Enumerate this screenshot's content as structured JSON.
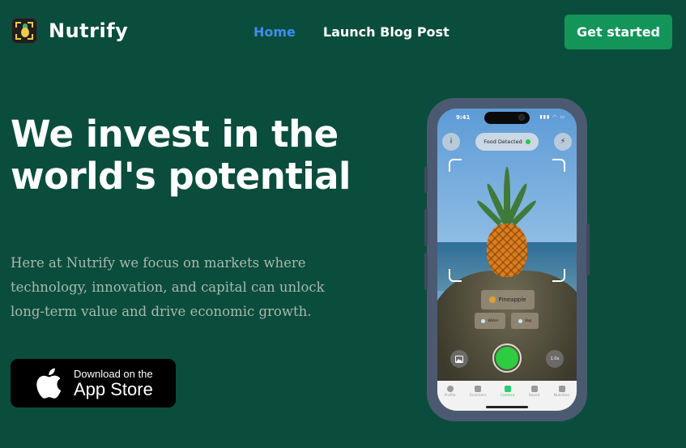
{
  "brand": {
    "name": "Nutrify",
    "accent": "#13955a",
    "background": "#0b4d3c",
    "link_active": "#3b8ef0"
  },
  "nav": {
    "links": [
      {
        "label": "Home",
        "active": true
      },
      {
        "label": "Launch Blog Post",
        "active": false
      }
    ],
    "cta_label": "Get started"
  },
  "hero": {
    "title": "We invest in the world's potential",
    "description": "Here at Nutrify we focus on markets where technology, innovation, and capital can unlock long-term value and drive economic growth.",
    "store_button": {
      "small": "Download on the",
      "big": "App Store",
      "icon": "apple-icon"
    }
  },
  "phone": {
    "status_time": "9:41",
    "status_icons": "▮▮▮ ◠ ▭",
    "info_icon_label": "i",
    "flash_icon_label": "⚡",
    "food_pill_label": "Food Detected",
    "detected_item": "Pineapple",
    "nutrient_chips": [
      "Water",
      "Veg"
    ],
    "zoom_label": "1.0x",
    "tabs": [
      {
        "label": "Profile",
        "active": false
      },
      {
        "label": "Scanners",
        "active": false
      },
      {
        "label": "Camera",
        "active": true
      },
      {
        "label": "Saved",
        "active": false
      },
      {
        "label": "Nutrition",
        "active": false
      }
    ]
  }
}
